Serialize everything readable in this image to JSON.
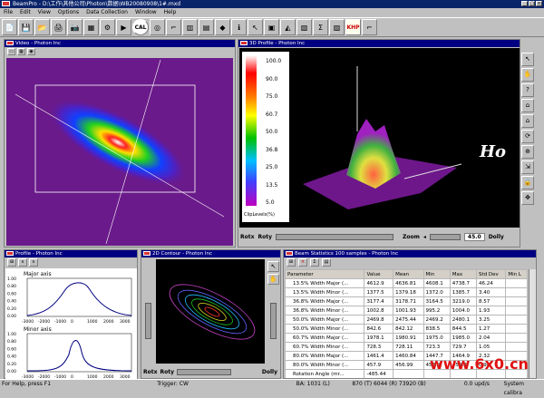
{
  "app": {
    "title": "BeamPro - D:\\工作\\其他公司\\Photon\\数据\\WB20080908\\1#.mxd",
    "menu": [
      "File",
      "Edit",
      "View",
      "Options",
      "Data Collection",
      "Window",
      "Help"
    ],
    "toolbar_icons": [
      "open-icon",
      "save-icon",
      "folder-icon",
      "print-icon",
      "camera-icon",
      "grid-icon",
      "settings-icon",
      "play-icon",
      "cal-icon",
      "beam-icon",
      "gun-icon",
      "bars-icon",
      "chart-icon",
      "photon-icon",
      "info-icon",
      "cursor-icon",
      "sample-icon",
      "3d-icon",
      "histo-icon",
      "stats-icon",
      "hist2-icon",
      "khp-icon",
      "gun2-icon"
    ],
    "cal_label": "CAL",
    "khp_label": "KHP"
  },
  "windows": {
    "video": {
      "title": "Video - Photon Inc"
    },
    "profile3d": {
      "title": "3D Profile - Photon Inc",
      "scale": [
        "100.0",
        "90.0",
        "75.0",
        "60.7",
        "50.0",
        "36.8",
        "25.0",
        "13.5",
        "5.0"
      ],
      "scale_label": "ClipLevels(%)",
      "rotx": "Rotx",
      "roty": "Roty",
      "zoom_label": "Zoom",
      "zoom_value": "45.0",
      "dolly": "Dolly",
      "overlay_text": "Ho"
    },
    "profile": {
      "title": "Profile - Photon Inc",
      "major_label": "Major axis",
      "minor_label": "Minor axis",
      "y_ticks": [
        "1.00",
        "0.80",
        "0.60",
        "0.40",
        "0.20",
        "0.00"
      ],
      "x_ticks": [
        "-3000",
        "-2000",
        "-1000",
        "0",
        "1000",
        "2000",
        "3000"
      ],
      "x_ticks_minor": [
        "-3000",
        "-2000",
        "-1000",
        "0",
        "1000",
        "2000",
        "3000"
      ]
    },
    "contour": {
      "title": "2D Contour - Photon Inc",
      "rotx": "Rotx",
      "roty": "Roty",
      "dolly": "Dolly"
    },
    "stats": {
      "title": "Beam Statistics 100 samples - Photon Inc",
      "headers": [
        "Parameter",
        "Value",
        "Mean",
        "Min",
        "Max",
        "Std Dev",
        "Min L"
      ],
      "rows": [
        [
          "13.5% Width Major (...",
          "4612.9",
          "4636.81",
          "4608.1",
          "4738.7",
          "46.24"
        ],
        [
          "13.5% Width Minor (...",
          "1377.5",
          "1379.18",
          "1372.0",
          "1385.7",
          "3.40"
        ],
        [
          "36.8% Width Major (...",
          "3177.4",
          "3178.71",
          "3164.5",
          "3219.0",
          "8.57"
        ],
        [
          "36.8% Width Minor (...",
          "1002.8",
          "1001.93",
          "995.2",
          "1004.0",
          "1.93"
        ],
        [
          "50.0% Width Major (...",
          "2469.8",
          "2475.44",
          "2469.2",
          "2480.1",
          "3.25"
        ],
        [
          "50.0% Width Minor (...",
          "842.6",
          "842.12",
          "838.5",
          "844.5",
          "1.27"
        ],
        [
          "60.7% Width Major (...",
          "1978.1",
          "1980.91",
          "1975.0",
          "1985.0",
          "2.04"
        ],
        [
          "60.7% Width Minor (...",
          "728.3",
          "728.11",
          "723.3",
          "729.7",
          "1.05"
        ],
        [
          "80.0% Width Major (...",
          "1461.4",
          "1460.84",
          "1447.7",
          "1464.9",
          "2.32"
        ],
        [
          "80.0% Width Minor (...",
          "457.9",
          "456.99",
          "453.9",
          "459.8",
          "0.98"
        ],
        [
          "Rotation Angle (mr...",
          "-485.44",
          "",
          "",
          "",
          ""
        ]
      ]
    }
  },
  "statusbar": {
    "help": "For Help, press F1",
    "trigger": "Trigger: CW",
    "ba": "BA:  1031 (L)",
    "coords": "870 (T)    6044 (R)    73920 (B)",
    "rate": "0.0 upd/s",
    "sys": "System calibra"
  },
  "watermark": "www.6x0.cn",
  "colors": {
    "title_active": "#0a246a",
    "beam_bg": "#6a1a8a",
    "watermark": "#e01010"
  }
}
